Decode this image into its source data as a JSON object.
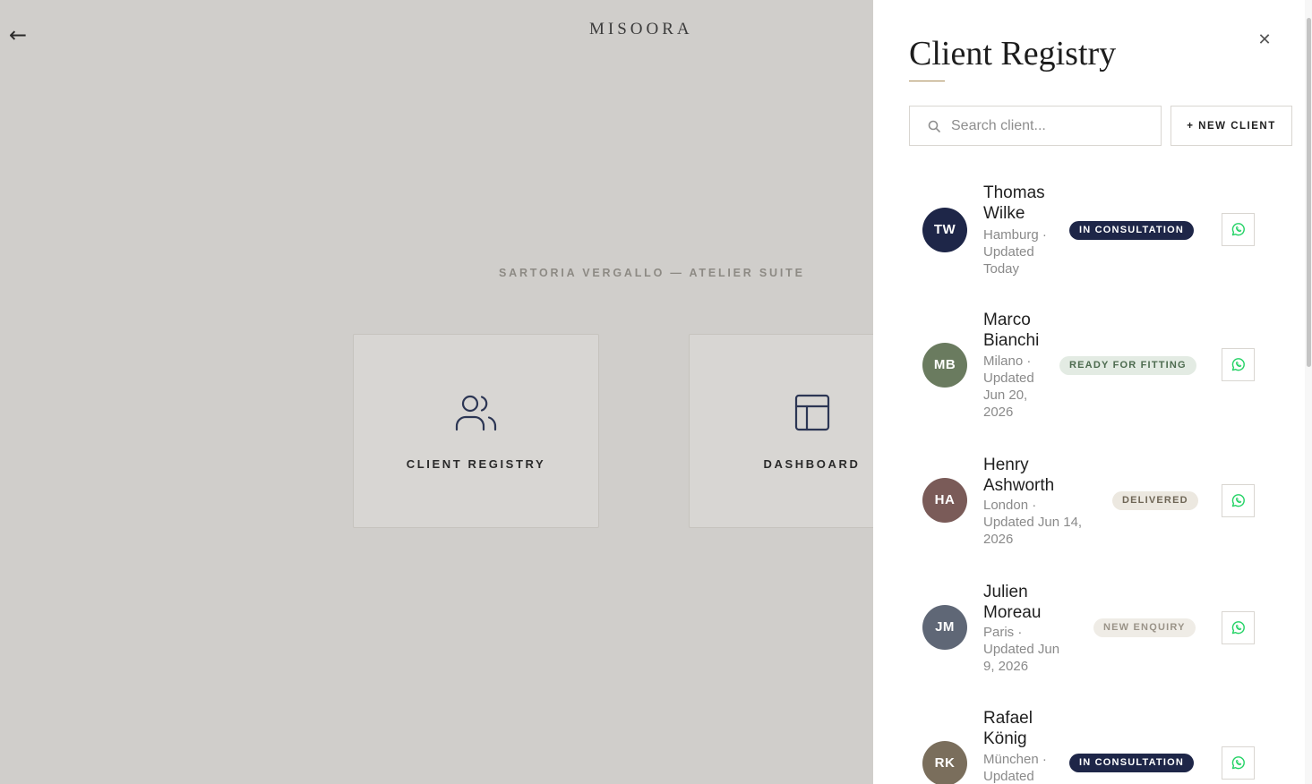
{
  "app": {
    "brand": "MISOORA",
    "back_icon": "arrow-left-icon",
    "suite_label": "SARTORIA VERGALLO — ATELIER SUITE",
    "tiles": [
      {
        "label": "CLIENT REGISTRY",
        "icon": "users-icon"
      },
      {
        "label": "DASHBOARD",
        "icon": "layout-icon"
      }
    ]
  },
  "drawer": {
    "title": "Client Registry",
    "close_icon": "close-icon",
    "search": {
      "placeholder": "Search client...",
      "value": "",
      "icon": "search-icon"
    },
    "new_client_label": "+ NEW CLIENT",
    "clients": [
      {
        "initials": "TW",
        "name_line1": "Thomas",
        "name_line2": "Wilke",
        "meta": [
          "Hamburg ·",
          "Updated",
          "Today"
        ],
        "status": "IN CONSULTATION",
        "avatar_color": "#1e2648",
        "status_style": "navy"
      },
      {
        "initials": "MB",
        "name_line1": "Marco",
        "name_line2": "Bianchi",
        "meta": [
          "Milano ·",
          "Updated",
          "Jun 20,",
          "2026"
        ],
        "status": "READY FOR FITTING",
        "avatar_color": "#6a7b5f",
        "status_style": "green"
      },
      {
        "initials": "HA",
        "name_line1": "Henry",
        "name_line2": "Ashworth",
        "meta": [
          "London ·",
          "Updated Jun 14,",
          "2026"
        ],
        "status": "DELIVERED",
        "avatar_color": "#7a5b58",
        "status_style": "beige"
      },
      {
        "initials": "JM",
        "name_line1": "Julien",
        "name_line2": "Moreau",
        "meta": [
          "Paris ·",
          "Updated Jun",
          "9, 2026"
        ],
        "status": "NEW ENQUIRY",
        "avatar_color": "#5f6776",
        "status_style": "grey"
      },
      {
        "initials": "RK",
        "name_line1": "Rafael",
        "name_line2": "König",
        "meta": [
          "München ·",
          "Updated"
        ],
        "status": "IN CONSULTATION",
        "avatar_color": "#7a6e5c",
        "status_style": "navy"
      }
    ],
    "contact_icon": "whatsapp-icon"
  },
  "colors": {
    "backdrop": "#d0cecb",
    "navy": "#1e2648",
    "accent_gold": "#a88c58",
    "whatsapp": "#25d366"
  }
}
